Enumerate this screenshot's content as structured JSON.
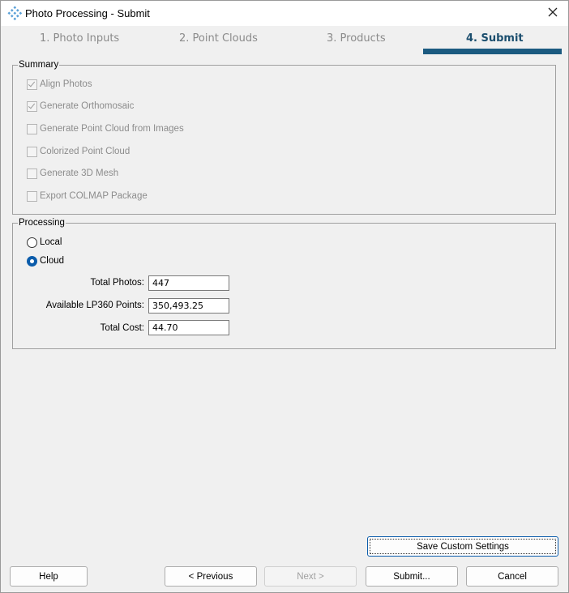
{
  "window": {
    "title": "Photo Processing - Submit"
  },
  "steps": [
    {
      "label": "1.  Photo Inputs",
      "active": false
    },
    {
      "label": "2.  Point Clouds",
      "active": false
    },
    {
      "label": "3.  Products",
      "active": false
    },
    {
      "label": "4.  Submit",
      "active": true
    }
  ],
  "summary": {
    "legend": "Summary",
    "items": [
      {
        "label": "Align Photos",
        "checked": true
      },
      {
        "label": "Generate Orthomosaic",
        "checked": true
      },
      {
        "label": "Generate Point Cloud from Images",
        "checked": false
      },
      {
        "label": "Colorized Point Cloud",
        "checked": false
      },
      {
        "label": "Generate 3D Mesh",
        "checked": false
      },
      {
        "label": "Export COLMAP Package",
        "checked": false
      }
    ]
  },
  "processing": {
    "legend": "Processing",
    "local_label": "Local",
    "cloud_label": "Cloud",
    "selected": "Cloud",
    "total_photos_label": "Total Photos:",
    "total_photos_value": "447",
    "available_points_label": "Available LP360 Points:",
    "available_points_value": "350,493.25",
    "total_cost_label": "Total Cost:",
    "total_cost_value": "44.70"
  },
  "buttons": {
    "save_custom_settings": "Save Custom Settings",
    "help": "Help",
    "previous": "< Previous",
    "next": "Next >",
    "submit": "Submit...",
    "cancel": "Cancel"
  }
}
